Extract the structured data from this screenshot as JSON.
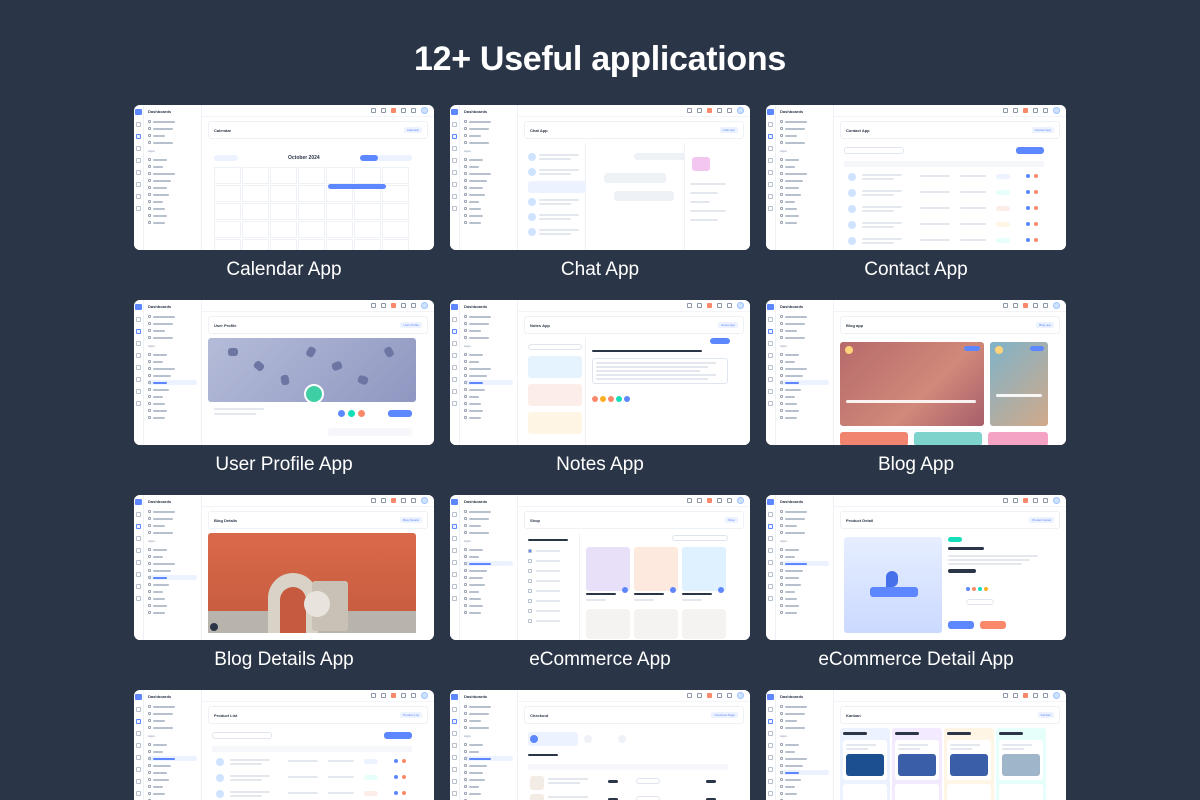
{
  "headline": "12+ Useful applications",
  "mini": {
    "brand": "Dashboards",
    "apps_caption": "Apps",
    "nav_items": [
      "eCommerce",
      "Analytics",
      "CRM",
      "Front Pages"
    ]
  },
  "cards": [
    {
      "label": "Calendar App",
      "page_title": "Calendar",
      "badge": "Calendar",
      "kind": "calendar",
      "heading": "October 2024"
    },
    {
      "label": "Chat App",
      "page_title": "Chat App",
      "badge": "Chat App",
      "kind": "chat"
    },
    {
      "label": "Contact App",
      "page_title": "Contact App",
      "badge": "Contact App",
      "kind": "table"
    },
    {
      "label": "User Profile App",
      "page_title": "User Profile",
      "badge": "User Profile",
      "kind": "profile"
    },
    {
      "label": "Notes App",
      "page_title": "Notes App",
      "badge": "Notes App",
      "kind": "notes"
    },
    {
      "label": "Blog App",
      "page_title": "Blog app",
      "badge": "Blog app",
      "kind": "blog"
    },
    {
      "label": "Blog Details App",
      "page_title": "Blog Details",
      "badge": "Blog Details",
      "kind": "blogdetail"
    },
    {
      "label": "eCommerce App",
      "page_title": "Shop",
      "badge": "Shop",
      "kind": "shop"
    },
    {
      "label": "eCommerce Detail App",
      "page_title": "Product Detail",
      "badge": "Product Detail",
      "kind": "product"
    },
    {
      "label": "",
      "page_title": "Product List",
      "badge": "Product List",
      "kind": "table"
    },
    {
      "label": "",
      "page_title": "Checkout",
      "badge": "Checkout Page",
      "kind": "checkout"
    },
    {
      "label": "",
      "page_title": "Kanban",
      "badge": "Kanban",
      "kind": "kanban"
    }
  ],
  "colors": {
    "background": "#2a3547",
    "primary": "#5d87ff",
    "text": "#ffffff"
  }
}
